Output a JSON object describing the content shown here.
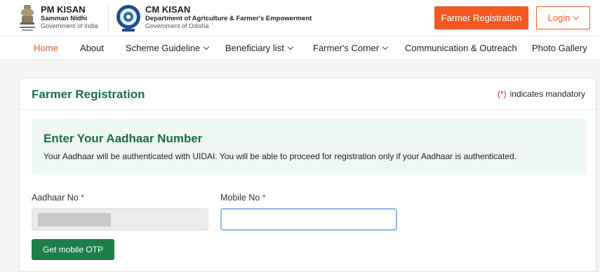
{
  "header": {
    "pm_title": "PM KISAN",
    "pm_sub1": "Samman Nidhi",
    "pm_sub2": "Government of India",
    "cm_title": "CM KISAN",
    "cm_sub1": "Department of Agriculture & Farmer's Empowerment",
    "cm_sub2": "Government of Odisha",
    "register_label": "Farmer Registration",
    "login_label": "Login"
  },
  "nav": {
    "items": [
      {
        "label": "Home",
        "active": true
      },
      {
        "label": "About"
      },
      {
        "label": "Scheme Guideline"
      },
      {
        "label": "Beneficiary list"
      },
      {
        "label": "Farmer's Corner"
      },
      {
        "label": "Communication & Outreach"
      },
      {
        "label": "Photo Gallery"
      }
    ]
  },
  "form": {
    "title": "Farmer Registration",
    "mandatory_marker": "(*)",
    "mandatory_text": "indicates mandatory",
    "info_title": "Enter Your Aadhaar Number",
    "info_text": "Your Aadhaar will be authenticated with UIDAI. You will be able to proceed for registration only if your Aadhaar is authenticated.",
    "aadhaar_label": "Aadhaar No",
    "mobile_label": "Mobile No",
    "required_marker": "*",
    "mobile_value": "",
    "otp_button": "Get mobile OTP"
  },
  "colors": {
    "accent_orange": "#f15a22",
    "brand_green": "#1e6b47",
    "button_green": "#1e7e4a",
    "required_red": "#d9262a"
  }
}
